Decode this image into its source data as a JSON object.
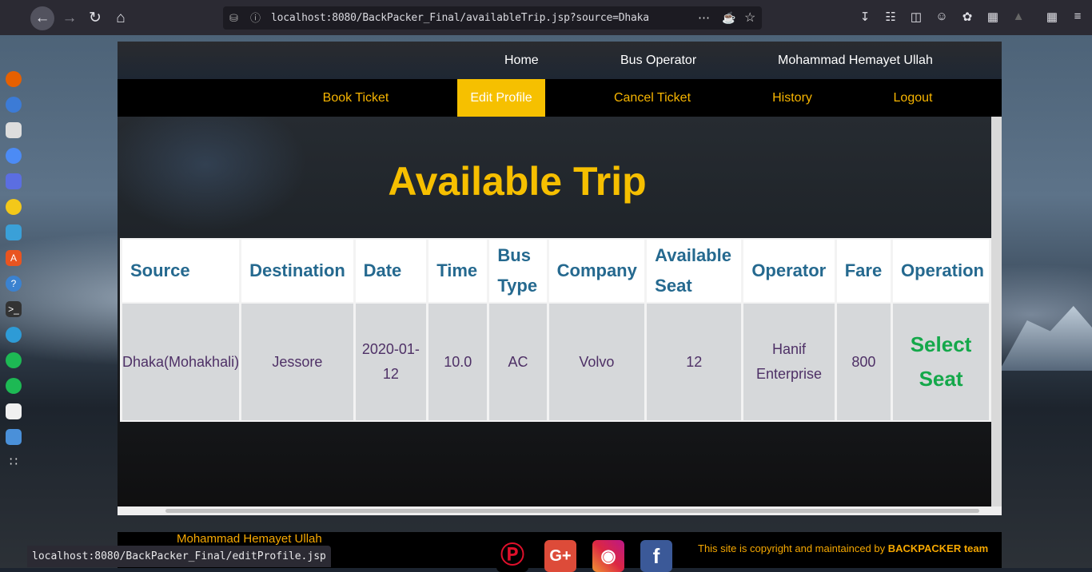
{
  "browser": {
    "url": "localhost:8080/BackPacker_Final/availableTrip.jsp?source=Dhaka",
    "status_url": "localhost:8080/BackPacker_Final/editProfile.jsp"
  },
  "topnav": {
    "home": "Home",
    "bus_operator": "Bus Operator",
    "user": "Mohammad Hemayet Ullah"
  },
  "menu": {
    "book": "Book Ticket",
    "edit_profile": "Edit Profile",
    "cancel": "Cancel Ticket",
    "history": "History",
    "logout": "Logout",
    "active": "Edit Profile"
  },
  "page": {
    "title": "Available Trip"
  },
  "table": {
    "headers": [
      "Source",
      "Destination",
      "Date",
      "Time",
      "Bus Type",
      "Company",
      "Available Seat",
      "Operator",
      "Fare",
      "Operation"
    ],
    "rows": [
      {
        "source": "Dhaka(Mohakhali)",
        "destination": "Jessore",
        "date": "2020-01-12",
        "time": "10.0",
        "bus_type": "AC",
        "company": "Volvo",
        "available_seat": "12",
        "operator": "Hanif Enterprise",
        "fare": "800",
        "operation": "Select Seat"
      }
    ]
  },
  "footer": {
    "author": "Mohammad Hemayet Ullah",
    "copyright_prefix": "This site is copyright and maintainced by ",
    "copyright_team": "BACKPACKER team",
    "social": [
      "pinterest-icon",
      "google-plus-icon",
      "instagram-icon",
      "facebook-icon"
    ]
  },
  "colors": {
    "accent": "#f6c000",
    "header_text": "#25698f",
    "cell_text": "#4e3066",
    "operation": "#14a84a"
  }
}
